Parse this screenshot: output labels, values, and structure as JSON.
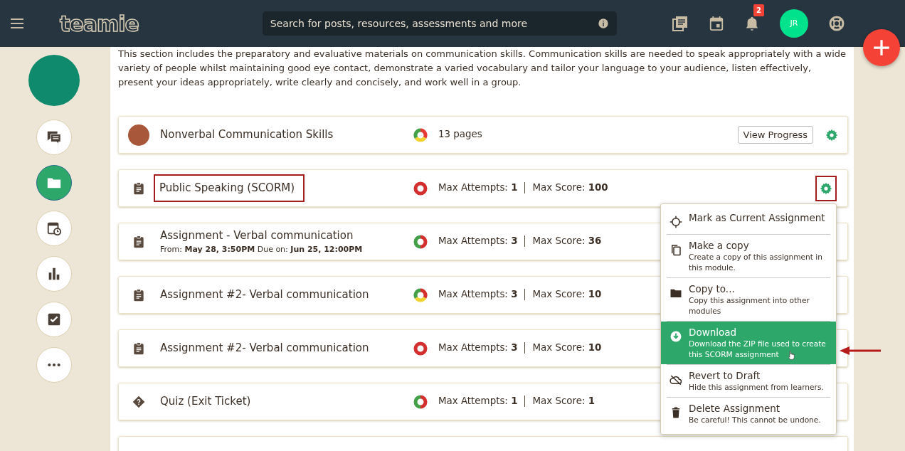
{
  "header": {
    "brand": "teamie",
    "search": {
      "placeholder": "Search for posts, resources, assessments and more"
    },
    "notifications": {
      "count": "2"
    },
    "avatar": {
      "initials": "JR"
    }
  },
  "sidebar": {
    "items": [
      {
        "kind": "messages",
        "selected": false
      },
      {
        "kind": "folder",
        "selected": true
      },
      {
        "kind": "schedule",
        "selected": false
      },
      {
        "kind": "stats",
        "selected": false
      },
      {
        "kind": "tasks",
        "selected": false
      },
      {
        "kind": "more",
        "selected": false
      }
    ]
  },
  "description": "This section includes the preparatory and evaluative materials on communication skills. Communication skills are needed to speak appropriately with a wide variety of people whilst maintaining good eye contact, demonstrate a varied vocabulary and tailor your language to your audience, listen effectively, present your ideas appropriately, write clearly and concisely, and work well in a group.",
  "rows": [
    {
      "kind": "resource",
      "title": "Nonverbal Communication Skills",
      "ring": [
        {
          "color": "#e53935"
        },
        {
          "color": "#f1d230"
        },
        {
          "color": "#43a047"
        }
      ],
      "meta": [
        "13 pages"
      ],
      "button": "View Progress",
      "gear": true
    },
    {
      "kind": "assignment",
      "title": "Public Speaking (SCORM)",
      "ring": [
        {
          "color": "#d32f2f"
        }
      ],
      "meta": [
        "Max Attempts: **1**",
        "Max Score: **100**"
      ],
      "gear": true,
      "annotated": true
    },
    {
      "kind": "assignment",
      "title": "Assignment - Verbal communication",
      "subtitle": "From: **May 28, 3:50PM**  Due on: **Jun 25, 12:00PM**",
      "ring": [
        {
          "color": "#d32f2f"
        },
        {
          "color": "#43a047"
        }
      ],
      "meta": [
        "Max Attempts: **3**",
        "Max Score: **36**"
      ]
    },
    {
      "kind": "assignment",
      "title": "Assignment #2- Verbal communication",
      "ring": [
        {
          "color": "#d32f2f"
        },
        {
          "color": "#f1d230"
        },
        {
          "color": "#43a047"
        }
      ],
      "meta": [
        "Max Attempts: **3**",
        "Max Score: **10**"
      ]
    },
    {
      "kind": "assignment",
      "title": "Assignment #2- Verbal communication",
      "ring": [
        {
          "color": "#d32f2f"
        }
      ],
      "meta": [
        "Max Attempts: **3**",
        "Max Score: **10**"
      ]
    },
    {
      "kind": "quiz",
      "title": "Quiz (Exit Ticket)",
      "ring": [
        {
          "color": "#d32f2f"
        },
        {
          "color": "#43a047"
        }
      ],
      "meta": [
        "Max Attempts: **1**",
        "Max Score: **1**"
      ]
    }
  ],
  "menu": {
    "items": [
      {
        "kind": "target",
        "title": "Mark as Current Assignment",
        "selected": false
      },
      {
        "kind": "copy",
        "title": "Make a copy",
        "description": "Create a copy of this assignment in this module.",
        "selected": false
      },
      {
        "kind": "folder",
        "title": "Copy to...",
        "description": "Copy this assignment into other modules",
        "selected": false
      },
      {
        "kind": "download",
        "title": "Download",
        "description": "Download the ZIP file used to create this SCORM assignment",
        "selected": true,
        "annotated": true
      },
      {
        "kind": "draft",
        "title": "Revert to Draft",
        "description": "Hide this assignment from learners.",
        "selected": false
      },
      {
        "kind": "delete",
        "title": "Delete Assignment",
        "description": "Be careful! This cannot be undone.",
        "selected": false
      }
    ]
  }
}
